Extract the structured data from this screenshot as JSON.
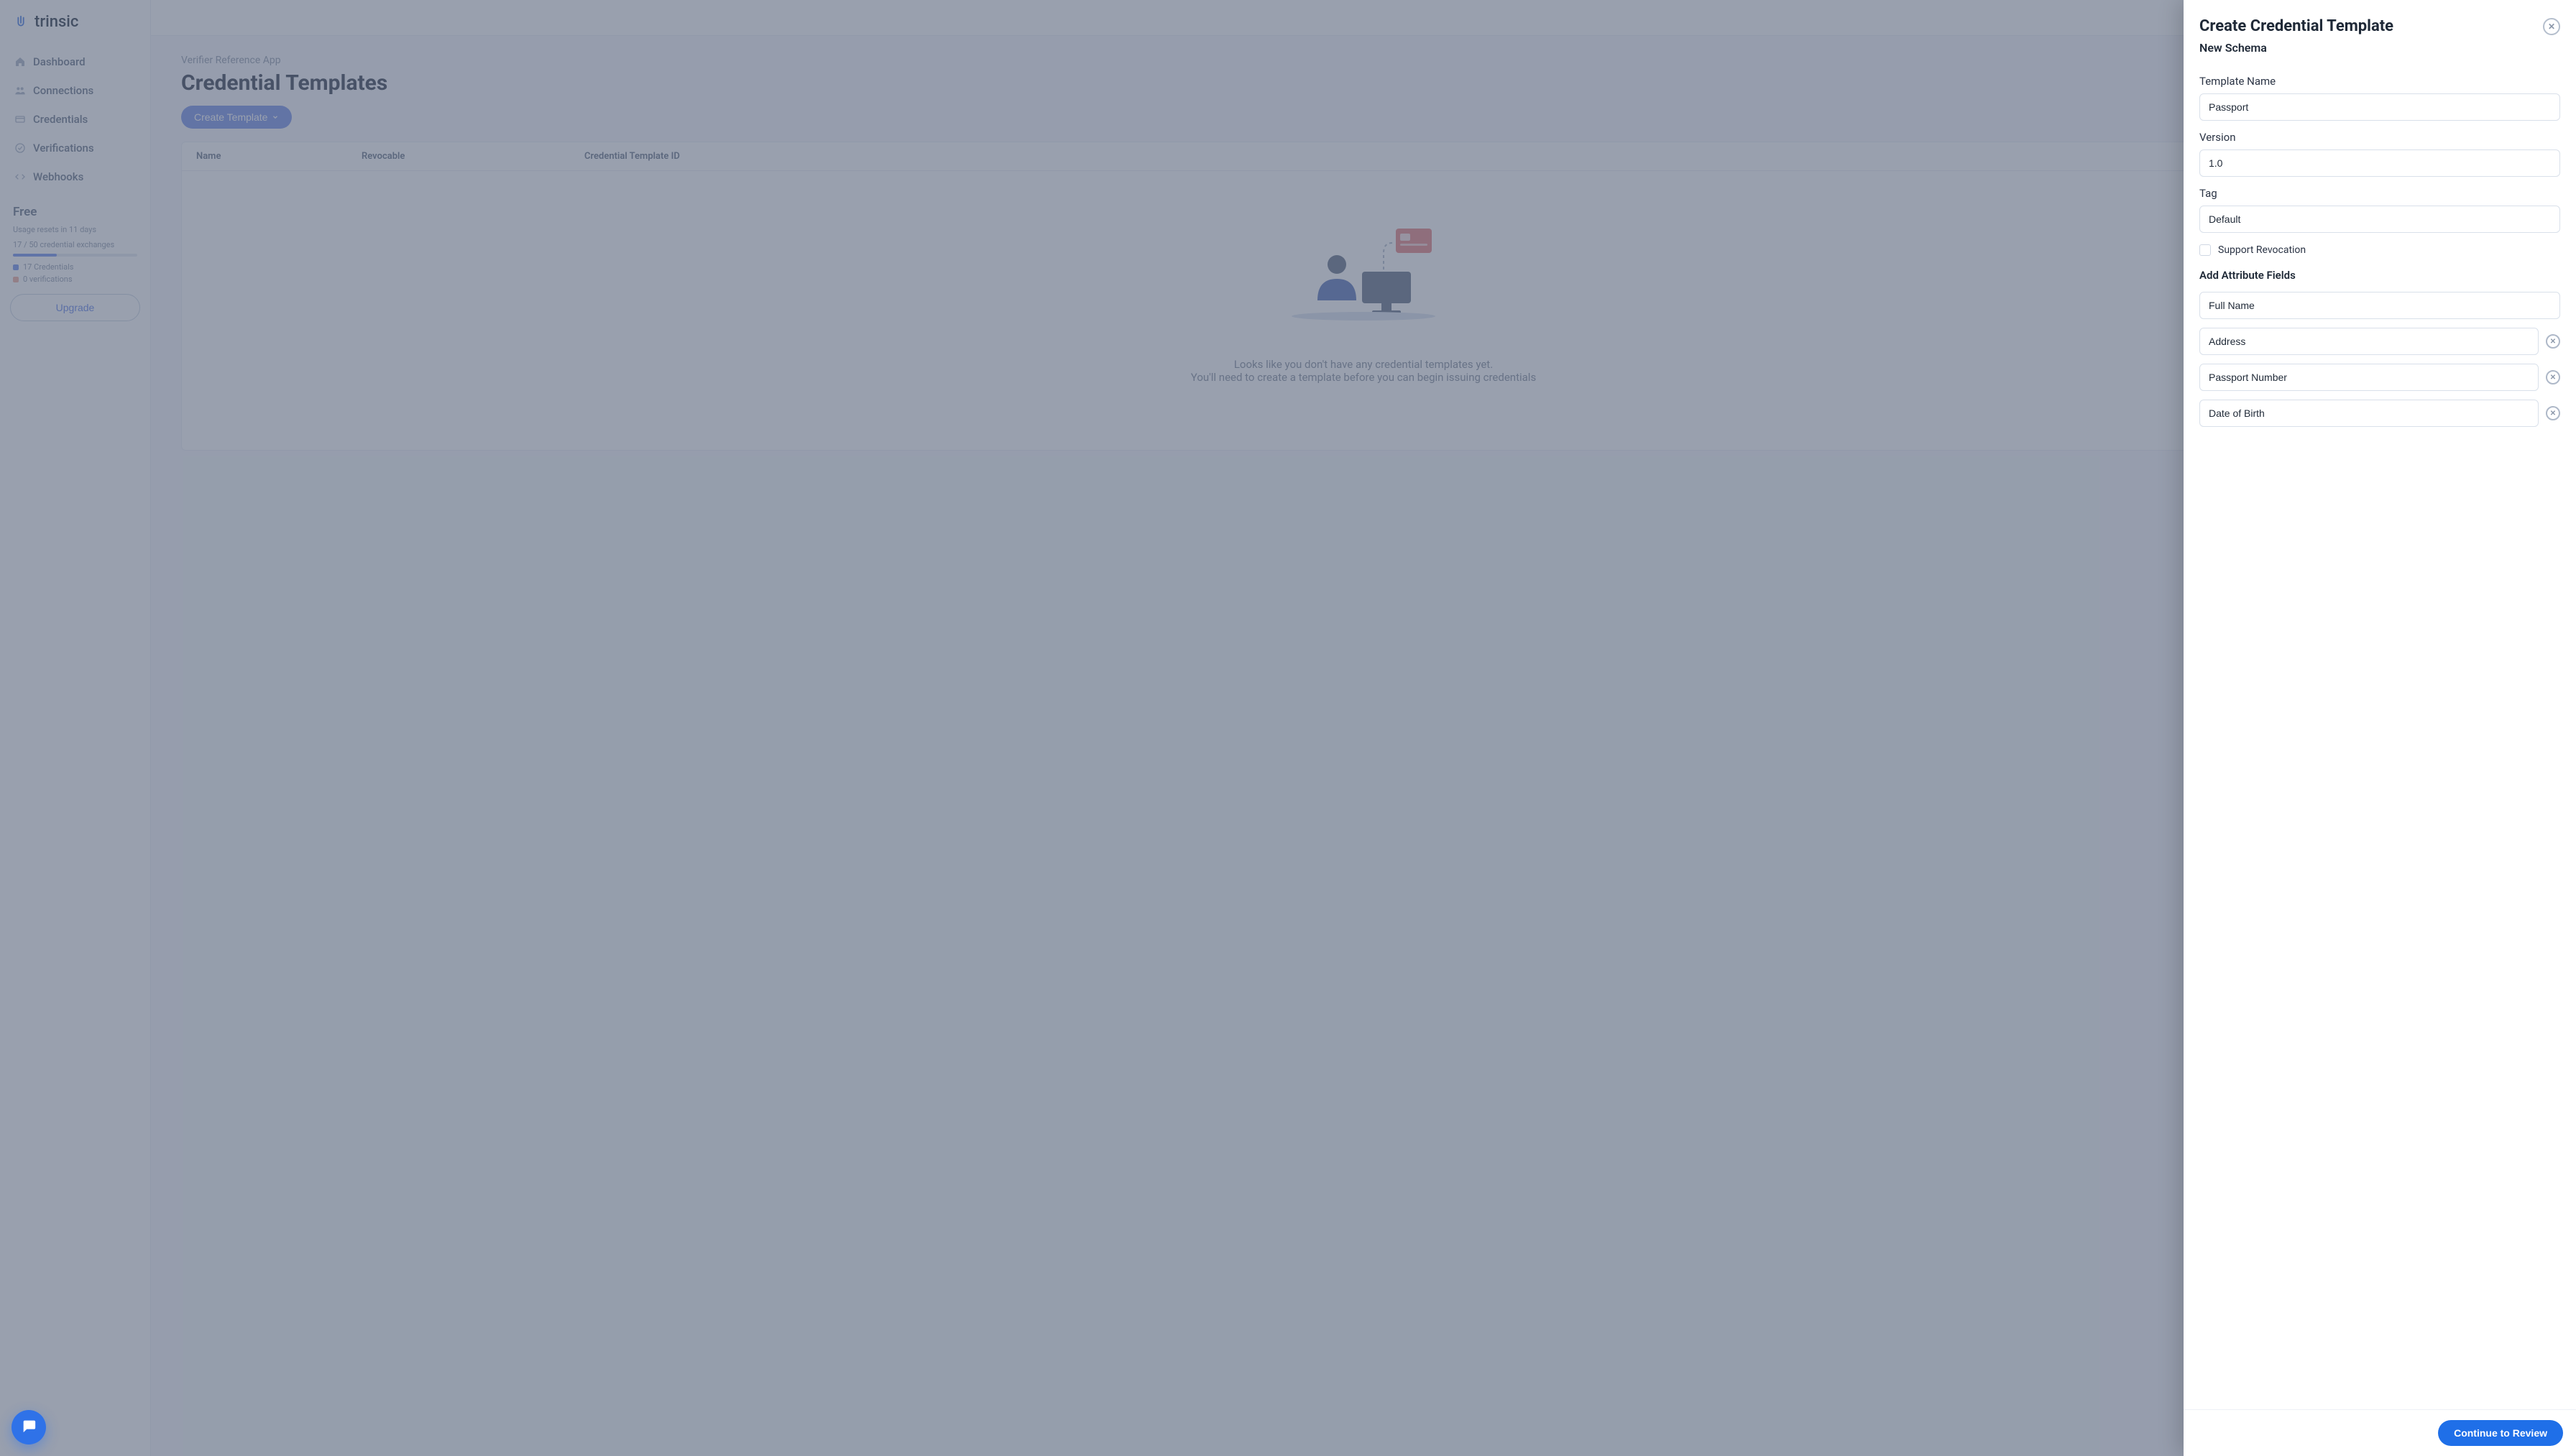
{
  "brand": {
    "name": "trinsic"
  },
  "sidebar": {
    "items": [
      {
        "label": "Dashboard"
      },
      {
        "label": "Connections"
      },
      {
        "label": "Credentials"
      },
      {
        "label": "Verifications"
      },
      {
        "label": "Webhooks"
      }
    ],
    "plan": {
      "name": "Free",
      "reset_text": "Usage resets in 11 days",
      "exchanges": "17 / 50 credential exchanges",
      "credentials_stat": "17 Credentials",
      "verifications_stat": "0 verifications",
      "upgrade_label": "Upgrade"
    }
  },
  "main": {
    "breadcrumb": "Verifier Reference App",
    "title": "Credential Templates",
    "create_button_label": "Create Template",
    "table_headers": {
      "name": "Name",
      "revocable": "Revocable",
      "id": "Credential Template ID"
    },
    "empty_line1": "Looks like you don't have any credential templates yet.",
    "empty_line2": "You'll need to create a template before you can begin issuing credentials"
  },
  "drawer": {
    "title": "Create Credential Template",
    "subtitle": "New Schema",
    "fields": {
      "template_name_label": "Template Name",
      "template_name_value": "Passport",
      "version_label": "Version",
      "version_value": "1.0",
      "tag_label": "Tag",
      "tag_value": "Default"
    },
    "revocation_label": "Support Revocation",
    "attributes_heading": "Add Attribute Fields",
    "attributes": [
      {
        "value": "Full Name",
        "removable": false
      },
      {
        "value": "Address",
        "removable": true
      },
      {
        "value": "Passport Number",
        "removable": true
      },
      {
        "value": "Date of Birth",
        "removable": true
      }
    ],
    "continue_label": "Continue to Review"
  }
}
